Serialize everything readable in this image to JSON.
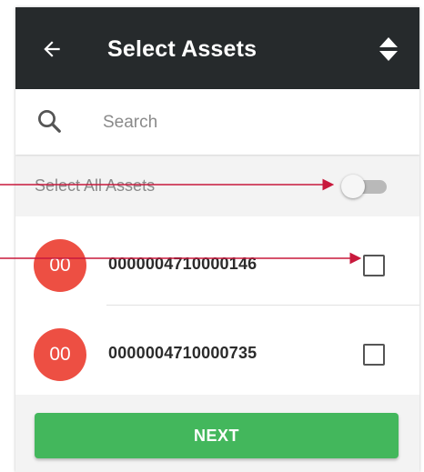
{
  "header": {
    "title": "Select Assets",
    "back_icon": "arrow-left-icon",
    "sort_icon": "sort-icon"
  },
  "search": {
    "placeholder": "Search",
    "value": "",
    "icon": "search-icon"
  },
  "select_all": {
    "label": "Select All Assets",
    "enabled": false
  },
  "assets": [
    {
      "avatar_text": "00",
      "id": "0000004710000146",
      "checked": false
    },
    {
      "avatar_text": "00",
      "id": "0000004710000735",
      "checked": false
    }
  ],
  "footer": {
    "next_label": "NEXT"
  },
  "colors": {
    "header_bg": "#262a2c",
    "avatar": "#ed4f43",
    "next_button": "#43b75c",
    "annotation_line": "#c8193c"
  }
}
